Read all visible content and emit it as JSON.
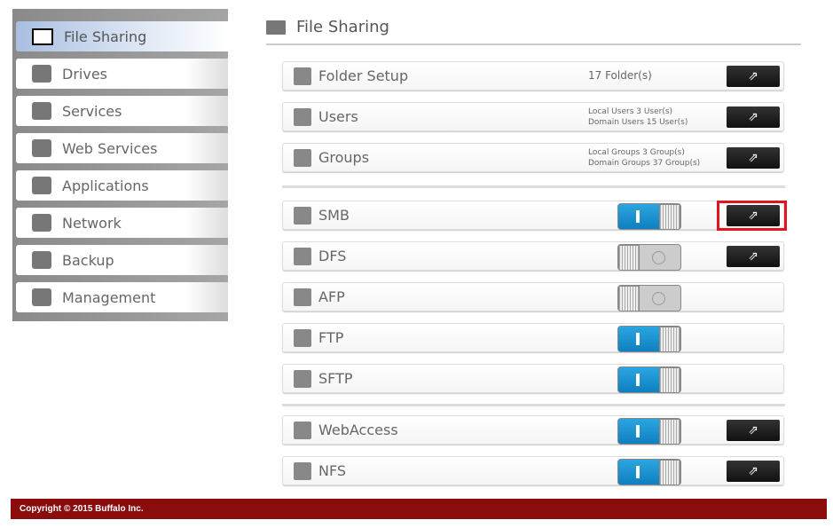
{
  "sidebar": {
    "items": [
      {
        "label": "File Sharing",
        "icon": "folder-icon",
        "active": true
      },
      {
        "label": "Drives",
        "icon": "drive-icon"
      },
      {
        "label": "Services",
        "icon": "services-icon"
      },
      {
        "label": "Web Services",
        "icon": "web-services-icon"
      },
      {
        "label": "Applications",
        "icon": "applications-icon"
      },
      {
        "label": "Network",
        "icon": "network-icon"
      },
      {
        "label": "Backup",
        "icon": "backup-icon"
      },
      {
        "label": "Management",
        "icon": "tools-icon"
      }
    ]
  },
  "header": {
    "title": "File Sharing"
  },
  "rows": [
    {
      "label": "Folder Setup",
      "info": [
        "17 Folder(s)"
      ],
      "button": true
    },
    {
      "label": "Users",
      "info": [
        "Local Users 3 User(s)",
        "Domain Users 15 User(s)"
      ],
      "button": true
    },
    {
      "label": "Groups",
      "info": [
        "Local Groups 3 Group(s)",
        "Domain Groups 37 Group(s)"
      ],
      "button": true
    },
    {
      "label": "SMB",
      "toggle": "on",
      "button": true,
      "highlighted": true
    },
    {
      "label": "DFS",
      "toggle": "off",
      "button": true
    },
    {
      "label": "AFP",
      "toggle": "off"
    },
    {
      "label": "FTP",
      "toggle": "on"
    },
    {
      "label": "SFTP",
      "toggle": "on"
    },
    {
      "label": "WebAccess",
      "toggle": "on",
      "button": true
    },
    {
      "label": "NFS",
      "toggle": "on",
      "button": true
    }
  ],
  "button_icon": "external-link-icon",
  "highlight_color": "#e0161f",
  "footer": {
    "copyright": "Copyright © 2015 Buffalo Inc."
  }
}
